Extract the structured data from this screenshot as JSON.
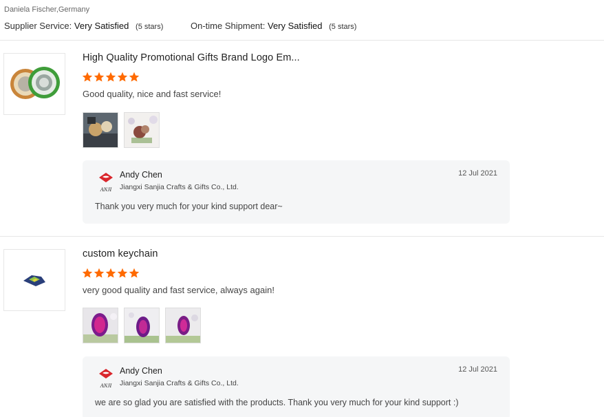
{
  "reviewer": "Daniela Fischer,Germany",
  "ratings": [
    {
      "label": "Supplier Service:",
      "value": "Very Satisfied",
      "stars": "(5 stars)"
    },
    {
      "label": "On-time Shipment:",
      "value": "Very Satisfied",
      "stars": "(5 stars)"
    }
  ],
  "colors": {
    "star": "#ff6a00",
    "reply_bg": "#f5f6f7",
    "divider": "#e6e6e6"
  },
  "reviews": [
    {
      "product_title": "High Quality Promotional Gifts Brand Logo Em...",
      "rating": 5,
      "comment": "Good quality, nice and fast service!",
      "photo_count": 2,
      "reply": {
        "name": "Andy Chen",
        "company": "Jiangxi Sanjia Crafts & Gifts Co., Ltd.",
        "date": "12 Jul 2021",
        "text": "Thank you very much for your kind support dear~"
      }
    },
    {
      "product_title": "custom keychain",
      "rating": 5,
      "comment": "very good quality and fast service, always again!",
      "photo_count": 3,
      "reply": {
        "name": "Andy Chen",
        "company": "Jiangxi Sanjia Crafts & Gifts Co., Ltd.",
        "date": "12 Jul 2021",
        "text": "we are so glad you are satisfied with the products. Thank you very much for your kind support :)"
      }
    }
  ]
}
